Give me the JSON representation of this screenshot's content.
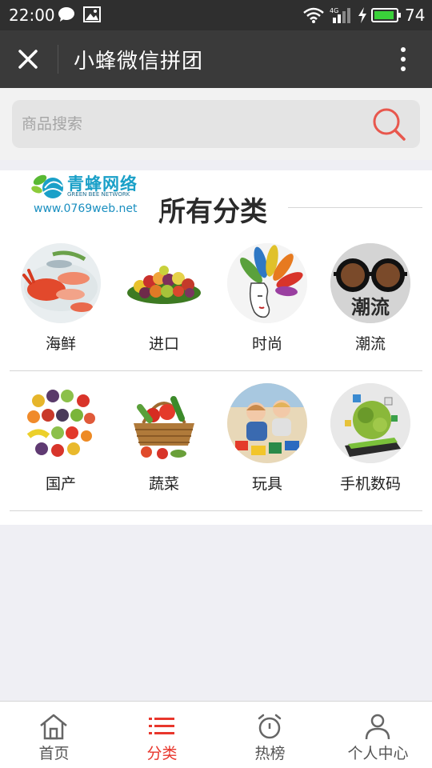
{
  "status_bar": {
    "time": "22:00",
    "network": "4G",
    "battery": "74"
  },
  "header": {
    "title": "小蜂微信拼团"
  },
  "search": {
    "placeholder": "商品搜索"
  },
  "watermark": {
    "name_cn": "青蜂网络",
    "name_en": "GREEN BEE NETWORK",
    "url": "www.0769web.net"
  },
  "section": {
    "heading": "所有分类"
  },
  "categories": [
    {
      "label": "海鲜",
      "icon": "seafood-image"
    },
    {
      "label": "进口",
      "icon": "imported-fruit-image"
    },
    {
      "label": "时尚",
      "icon": "fashion-image"
    },
    {
      "label": "潮流",
      "icon": "trend-glasses-image",
      "overlay_text": "潮流"
    },
    {
      "label": "国产",
      "icon": "domestic-fruit-image"
    },
    {
      "label": "蔬菜",
      "icon": "vegetable-basket-image"
    },
    {
      "label": "玩具",
      "icon": "toys-image"
    },
    {
      "label": "手机数码",
      "icon": "digital-image"
    }
  ],
  "tabbar": [
    {
      "label": "首页",
      "icon": "home-icon",
      "active": false
    },
    {
      "label": "分类",
      "icon": "list-icon",
      "active": true
    },
    {
      "label": "热榜",
      "icon": "alarm-clock-icon",
      "active": false
    },
    {
      "label": "个人中心",
      "icon": "person-icon",
      "active": false
    }
  ],
  "colors": {
    "accent": "#e8362c",
    "navbar": "#3a3a3a",
    "statusbar": "#2f2f2f",
    "background": "#efeff4"
  }
}
